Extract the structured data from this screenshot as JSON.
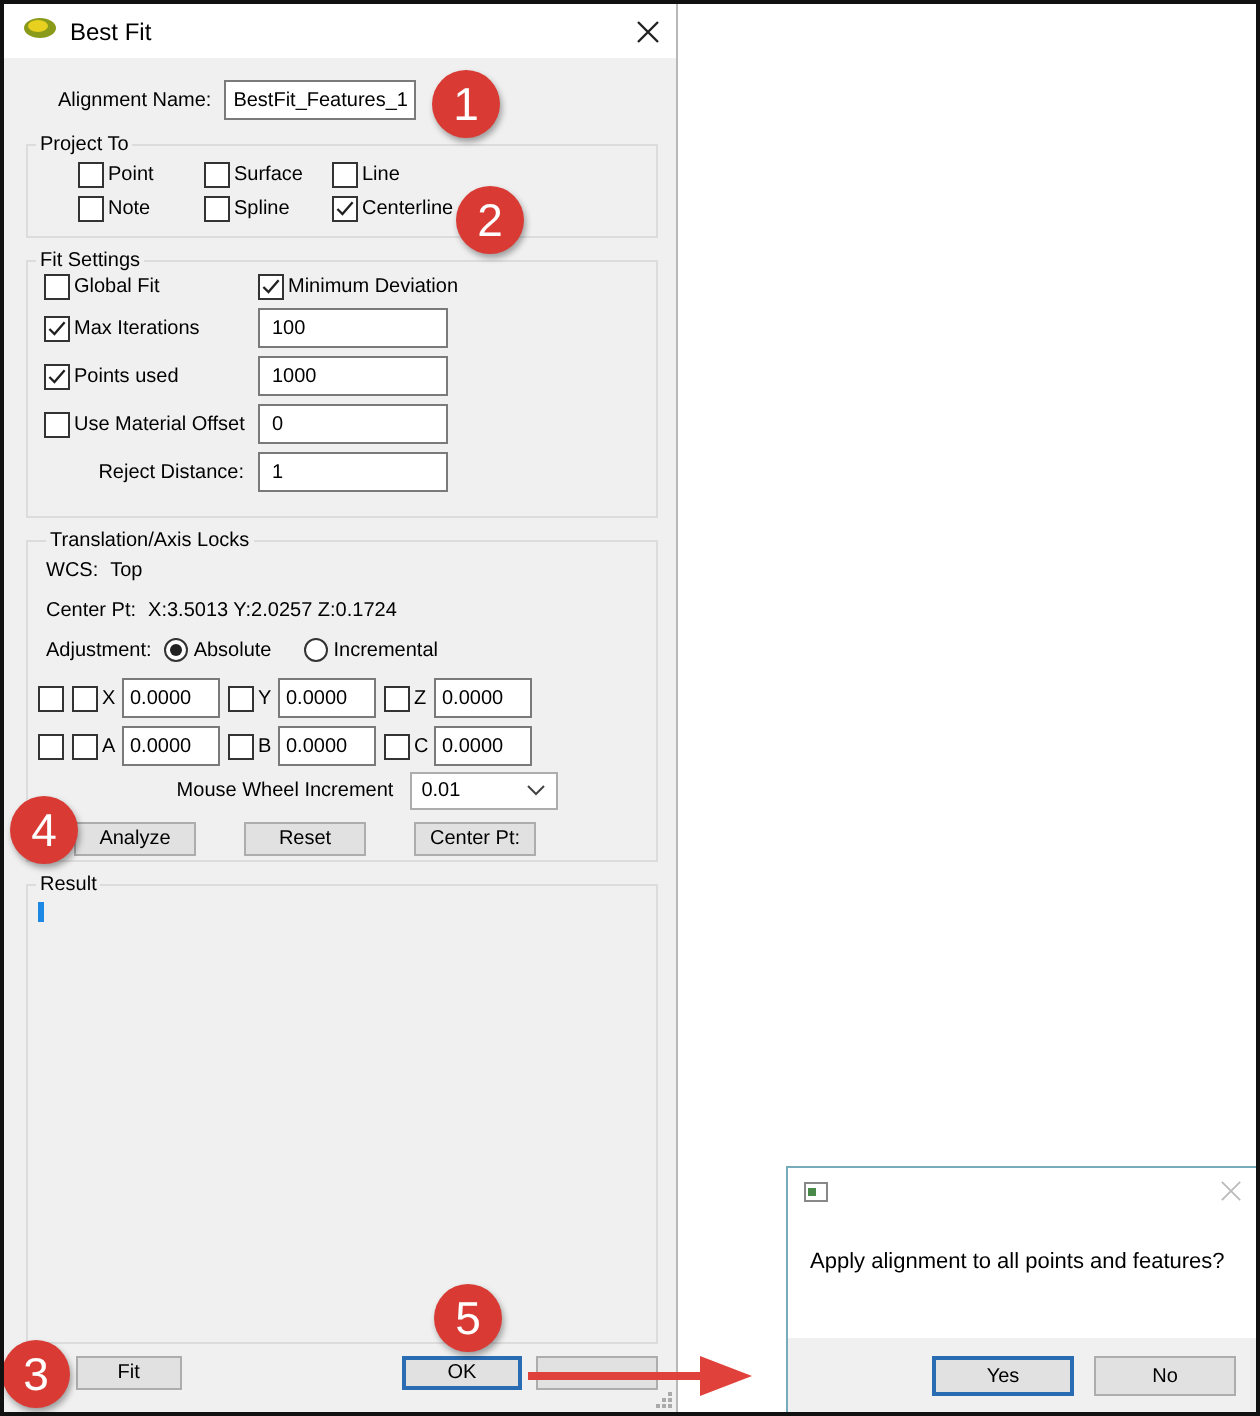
{
  "window": {
    "title": "Best Fit"
  },
  "alignment_name": {
    "label": "Alignment Name:",
    "value": "BestFit_Features_1"
  },
  "project_to": {
    "title": "Project To",
    "options": [
      {
        "label": "Point",
        "checked": false
      },
      {
        "label": "Surface",
        "checked": false
      },
      {
        "label": "Line",
        "checked": false
      },
      {
        "label": "Note",
        "checked": false
      },
      {
        "label": "Spline",
        "checked": false
      },
      {
        "label": "Centerline",
        "checked": true
      }
    ]
  },
  "fit_settings": {
    "title": "Fit Settings",
    "items": [
      {
        "kind": "checkbox",
        "label": "Global Fit",
        "checked": false
      },
      {
        "kind": "checkbox",
        "label": "Minimum Deviation",
        "checked": true
      },
      {
        "kind": "checkbox",
        "label": "Max Iterations",
        "checked": true
      },
      {
        "kind": "field",
        "value": "100"
      },
      {
        "kind": "checkbox",
        "label": "Points used",
        "checked": true
      },
      {
        "kind": "field",
        "value": "1000"
      },
      {
        "kind": "checkbox",
        "label": "Use Material Offset",
        "checked": false
      },
      {
        "kind": "field",
        "value": "0"
      },
      {
        "kind": "label",
        "label": "Reject Distance:"
      },
      {
        "kind": "field",
        "value": "1"
      }
    ]
  },
  "locks": {
    "title": "Translation/Axis Locks",
    "wcs": {
      "label": "WCS:",
      "value": "Top"
    },
    "center_pt": {
      "label": "Center Pt:",
      "value": "X:3.5013 Y:2.0257 Z:0.1724"
    },
    "adjustment": {
      "label": "Adjustment:",
      "options": [
        {
          "label": "Absolute",
          "selected": true
        },
        {
          "label": "Incremental",
          "selected": false
        }
      ]
    },
    "axis_rows": [
      {
        "checked": false,
        "axes": [
          {
            "label": "X",
            "checked": false,
            "value": "0.0000"
          },
          {
            "label": "Y",
            "checked": false,
            "value": "0.0000"
          },
          {
            "label": "Z",
            "checked": false,
            "value": "0.0000"
          }
        ]
      },
      {
        "checked": false,
        "axes": [
          {
            "label": "A",
            "checked": false,
            "value": "0.0000"
          },
          {
            "label": "B",
            "checked": false,
            "value": "0.0000"
          },
          {
            "label": "C",
            "checked": false,
            "value": "0.0000"
          }
        ]
      }
    ],
    "mouse_wheel": {
      "label": "Mouse Wheel Increment",
      "value": "0.01"
    },
    "buttons": [
      "Analyze",
      "Reset",
      "Center Pt:"
    ]
  },
  "result": {
    "title": "Result"
  },
  "footer_buttons": [
    {
      "label": "Fit",
      "focused": false
    },
    {
      "label": "OK",
      "focused": true
    },
    {
      "focused": false
    }
  ],
  "message_box": {
    "text": "Apply alignment to all points and features?",
    "buttons": [
      {
        "label": "Yes",
        "focused": true
      },
      {
        "label": "No",
        "focused": false
      }
    ]
  },
  "callouts": [
    {
      "number": "1"
    },
    {
      "number": "2"
    },
    {
      "number": "4"
    },
    {
      "number": "3"
    },
    {
      "number": "5"
    }
  ]
}
